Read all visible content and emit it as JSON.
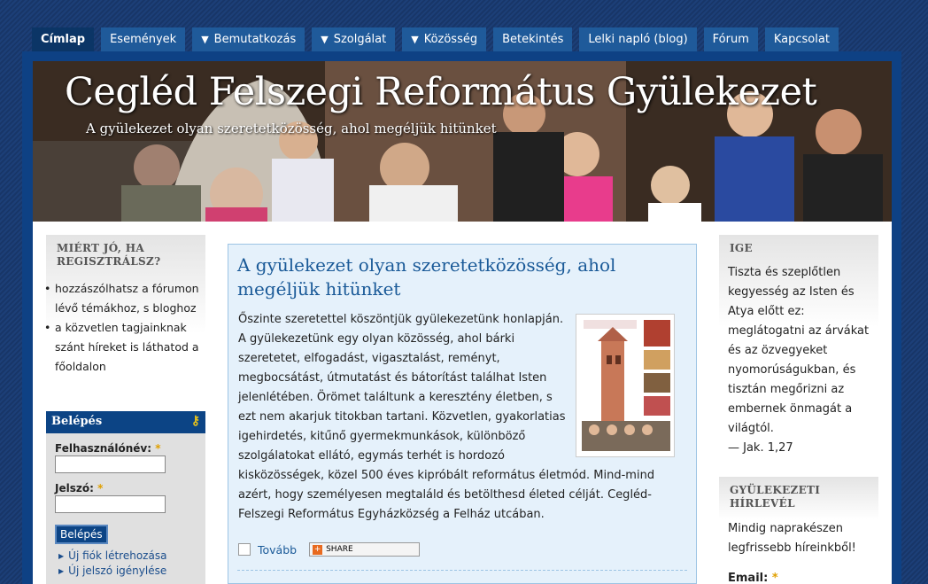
{
  "nav": {
    "items": [
      {
        "label": "Címlap",
        "dropdown": false
      },
      {
        "label": "Események",
        "dropdown": false
      },
      {
        "label": "Bemutatkozás",
        "dropdown": true
      },
      {
        "label": "Szolgálat",
        "dropdown": true
      },
      {
        "label": "Közösség",
        "dropdown": true
      },
      {
        "label": "Betekintés",
        "dropdown": false
      },
      {
        "label": "Lelki napló (blog)",
        "dropdown": false
      },
      {
        "label": "Fórum",
        "dropdown": false
      },
      {
        "label": "Kapcsolat",
        "dropdown": false
      }
    ]
  },
  "banner": {
    "title": "Cegléd Felszegi Református Gyülekezet",
    "subtitle": "A gyülekezet olyan szeretetközösség, ahol megéljük hitünket"
  },
  "why": {
    "heading": "Miért jó, ha regisztrálsz?",
    "items": [
      "hozzászólhatsz a fórumon lévő témákhoz, s bloghoz",
      "a közvetlen tagjainknak szánt híreket is láthatod a főoldalon"
    ]
  },
  "login": {
    "heading": "Belépés",
    "username_label": "Felhasználónév:",
    "password_label": "Jelszó:",
    "required_mark": "*",
    "submit_label": "Belépés",
    "links": [
      "Új fiók létrehozása",
      "Új jelszó igénylése"
    ]
  },
  "article": {
    "title": "A gyülekezet olyan szeretetközösség, ahol megéljük hitünket",
    "body": "Őszinte szeretettel köszöntjük gyülekezetünk honlapján. A gyülekezetünk egy olyan közösség, ahol bárki szeretetet, elfogadást, vigasztalást, reményt, megbocsátást, útmutatást és bátorítást találhat Isten jelenlétében. Örömet találtunk a keresztény életben, s ezt nem akarjuk titokban tartani. Közvetlen, gyakorlatias igehirdetés, kitűnő gyermekmunkások, különböző szolgálatokat ellátó, egymás terhét is hordozó kisközösségek, közel 500 éves kipróbált református életmód. Mind-mind azért, hogy személyesen megtaláld és betölthesd életed célját. Cegléd-Felszegi Református Egyházközség a Felház utcában.",
    "more_label": "Tovább",
    "share_label": "SHARE"
  },
  "ige": {
    "heading": "Ige",
    "text": "Tiszta és szeplőtlen kegyesség az Isten és Atya előtt ez: meglátogatni az árvákat és az özvegyeket nyomorúságukban, és tisztán megőrizni az embernek önmagát a világtól.",
    "reference": "— Jak. 1,27"
  },
  "newsletter": {
    "heading": "Gyülekezeti hírlevél",
    "text": "Mindig naprakészen legfrissebb híreinkből!",
    "email_label": "Email:",
    "required_mark": "*"
  },
  "colors": {
    "page_bg": "#1a3a6e",
    "nav_bg": "#1f5a9a",
    "nav_active": "#0b3566",
    "article_bg": "#e5f1fb",
    "link": "#1a5a98",
    "required": "#e0a000"
  }
}
